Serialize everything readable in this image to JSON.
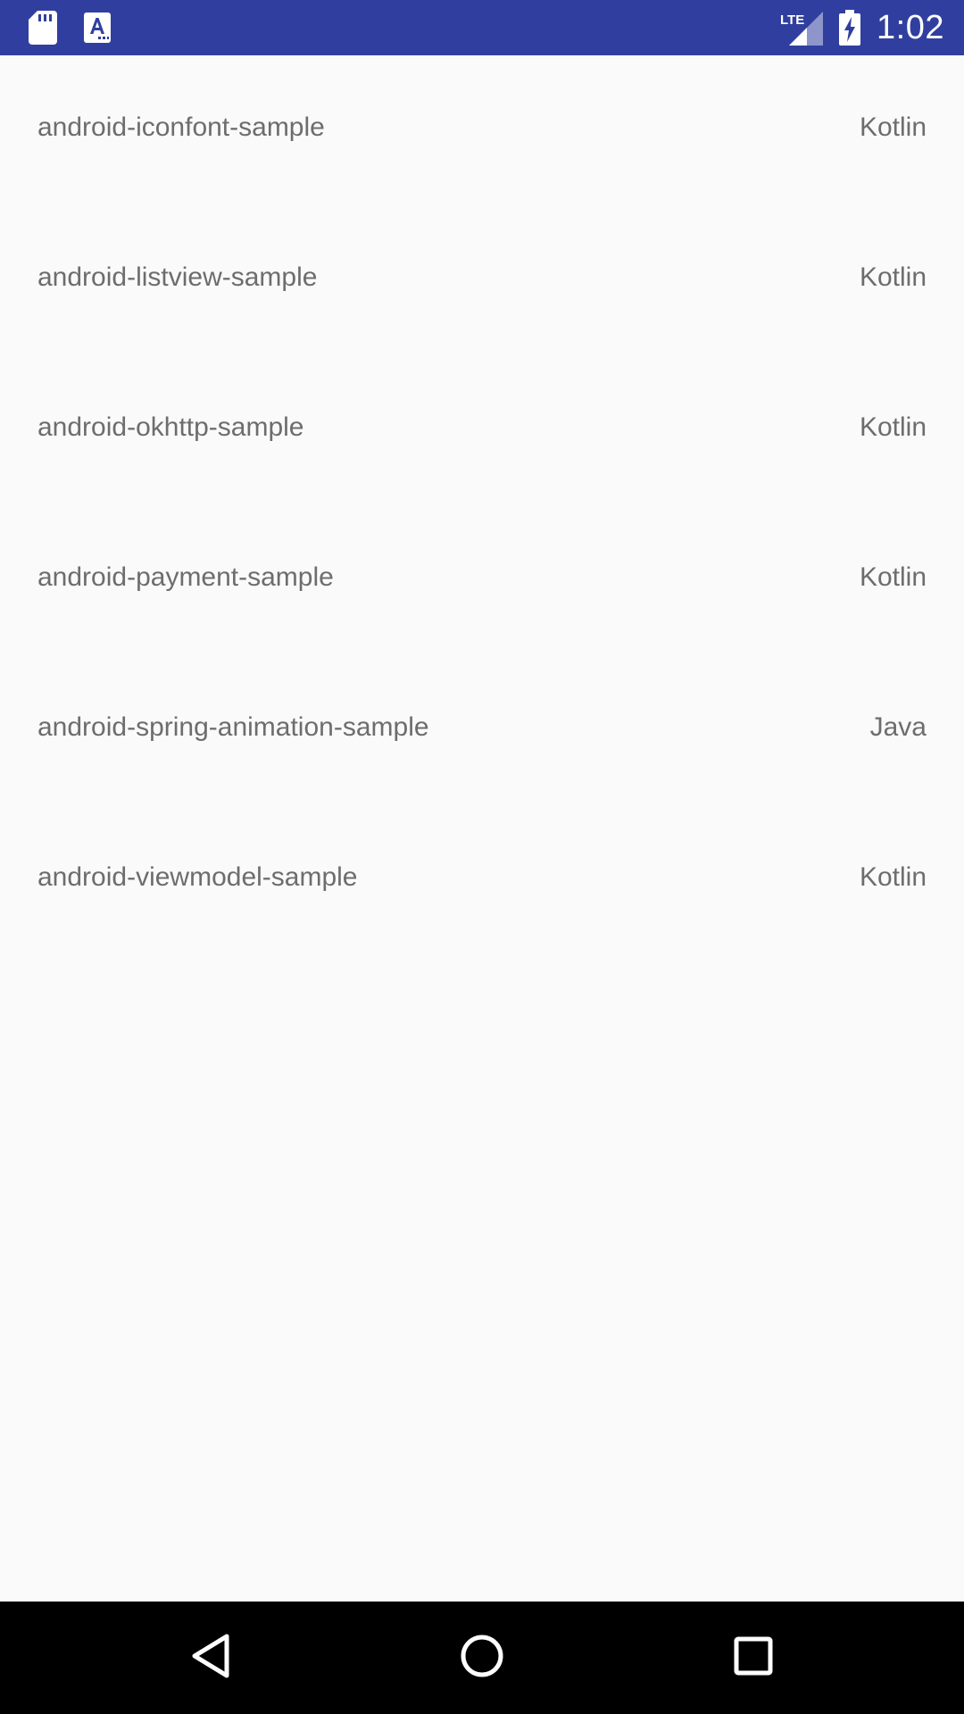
{
  "status_bar": {
    "time": "1:02",
    "network_label": "LTE",
    "icons": [
      "sd-card-icon",
      "text-recognition-icon",
      "lte-signal-icon",
      "battery-charging-icon"
    ]
  },
  "repos": [
    {
      "name": "android-iconfont-sample",
      "language": "Kotlin"
    },
    {
      "name": "android-listview-sample",
      "language": "Kotlin"
    },
    {
      "name": "android-okhttp-sample",
      "language": "Kotlin"
    },
    {
      "name": "android-payment-sample",
      "language": "Kotlin"
    },
    {
      "name": "android-spring-animation-sample",
      "language": "Java"
    },
    {
      "name": "android-viewmodel-sample",
      "language": "Kotlin"
    }
  ],
  "colors": {
    "status_bar": "#303f9f",
    "background": "#fafafa",
    "text": "#6d6d6d",
    "nav_bar": "#000000"
  },
  "nav_bar": {
    "icons": [
      "back-icon",
      "home-icon",
      "recents-icon"
    ]
  }
}
